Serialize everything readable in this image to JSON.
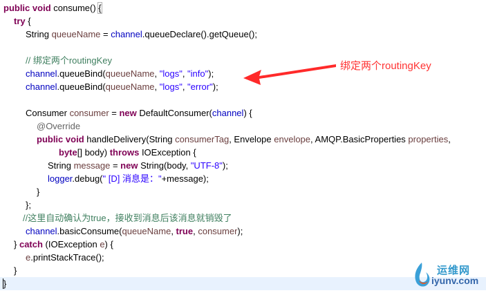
{
  "code": {
    "l1": {
      "public": "public",
      "void": "void",
      "name": " consume() ",
      "brace": "{"
    },
    "l2": {
      "try": "try",
      "rest": " {"
    },
    "l3": {
      "type": "String ",
      "var": "queueName",
      "eq": " = ",
      "field": "channel",
      "rest": ".queueDeclare().getQueue();"
    },
    "l5": {
      "comment": "// 绑定两个routingKey"
    },
    "l6": {
      "field": "channel",
      "m": ".queueBind(",
      "var": "queueName",
      "c1": ", ",
      "s1": "\"logs\"",
      "c2": ", ",
      "s2": "\"info\"",
      "end": ");"
    },
    "l7": {
      "field": "channel",
      "m": ".queueBind(",
      "var": "queueName",
      "c1": ", ",
      "s1": "\"logs\"",
      "c2": ", ",
      "s2": "\"error\"",
      "end": ");"
    },
    "l9": {
      "type": "Consumer ",
      "var": "consumer",
      "eq": " = ",
      "new": "new",
      "cls": " DefaultConsumer(",
      "field": "channel",
      "end": ") {"
    },
    "l10": {
      "annotation": "@Override"
    },
    "l11": {
      "public": "public",
      "void": "void",
      "method": " handleDelivery(String ",
      "v1": "consumerTag",
      "t2": ", Envelope ",
      "v2": "envelope",
      "t3": ", AMQP.BasicProperties ",
      "v3": "properties",
      "end": ","
    },
    "l12": {
      "byte": "byte",
      "mid": "[] body) ",
      "throws": "throws",
      "end": " IOException {"
    },
    "l13": {
      "type": "String ",
      "var": "message",
      "eq": " = ",
      "new": "new",
      "mid": " String(body, ",
      "str": "\"UTF-8\"",
      "end": ");"
    },
    "l14": {
      "field": "logger",
      "m": ".debug(",
      "str": "\" [D] 消息是：\"",
      "end": "+message);"
    },
    "l15": {
      "text": "}"
    },
    "l16": {
      "text": "};"
    },
    "l17": {
      "comment": "//这里自动确认为true，接收到消息后该消息就销毁了"
    },
    "l18": {
      "field": "channel",
      "m": ".basicConsume(",
      "var": "queueName",
      "c1": ", ",
      "true": "true",
      "c2": ", ",
      "var2": "consumer",
      "end": ");"
    },
    "l19": {
      "pre": "} ",
      "catch": "catch",
      "mid": " (IOException ",
      "var": "e",
      "end": ") {"
    },
    "l20": {
      "var": "e",
      "end": ".printStackTrace();"
    },
    "l21": {
      "text": "}"
    },
    "l22": {
      "text": "}"
    }
  },
  "annotation": {
    "label": "绑定两个routingKey",
    "color": "#ff3333"
  },
  "watermark": {
    "cn": "运维网",
    "en": "iyunv.com"
  },
  "colors": {
    "keyword": "#7f0055",
    "field": "#0000c0",
    "local_var": "#6a3e3e",
    "string": "#2a00ff",
    "comment": "#3f7f5f",
    "annotation": "#646464",
    "current_line": "#e8f2fe"
  }
}
